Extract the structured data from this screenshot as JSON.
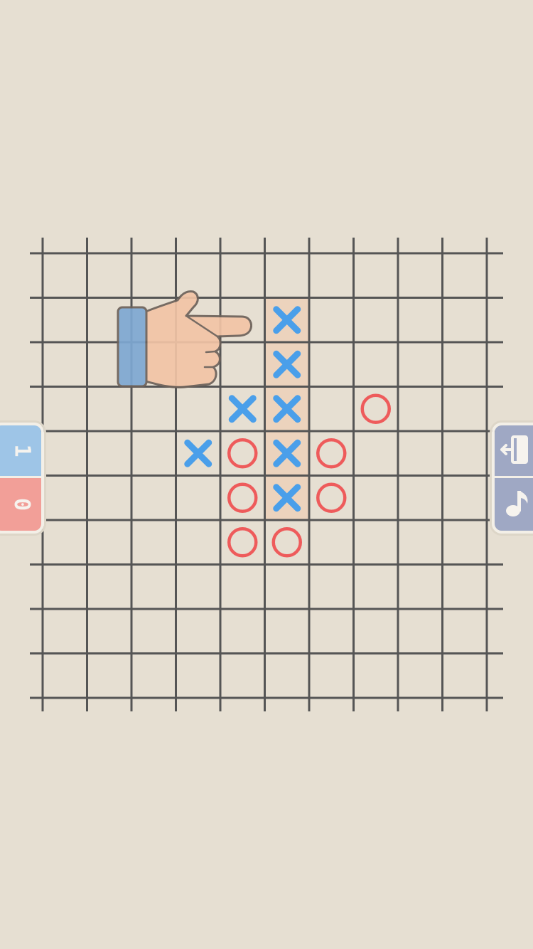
{
  "board": {
    "rows": 10,
    "cols": 10,
    "line_color": "#555555",
    "highlight_color": "#ecd3bd",
    "x_color": "#4a9fea",
    "o_color": "#ee5b5b",
    "winning_line": [
      [
        1,
        5
      ],
      [
        2,
        5
      ],
      [
        3,
        5
      ],
      [
        4,
        5
      ],
      [
        5,
        5
      ]
    ],
    "pieces": [
      {
        "r": 1,
        "c": 5,
        "type": "X"
      },
      {
        "r": 2,
        "c": 5,
        "type": "X"
      },
      {
        "r": 3,
        "c": 4,
        "type": "X"
      },
      {
        "r": 3,
        "c": 5,
        "type": "X"
      },
      {
        "r": 3,
        "c": 7,
        "type": "O"
      },
      {
        "r": 4,
        "c": 3,
        "type": "X"
      },
      {
        "r": 4,
        "c": 4,
        "type": "O"
      },
      {
        "r": 4,
        "c": 5,
        "type": "X"
      },
      {
        "r": 4,
        "c": 6,
        "type": "O"
      },
      {
        "r": 5,
        "c": 4,
        "type": "O"
      },
      {
        "r": 5,
        "c": 5,
        "type": "X"
      },
      {
        "r": 5,
        "c": 6,
        "type": "O"
      },
      {
        "r": 6,
        "c": 4,
        "type": "O"
      },
      {
        "r": 6,
        "c": 5,
        "type": "O"
      }
    ]
  },
  "scores": {
    "blue": "1",
    "red": "0",
    "blue_color": "#9ec5e7",
    "red_color": "#f29f98"
  },
  "menu": {
    "exit_icon": "exit-door-icon",
    "music_icon": "music-note-icon",
    "button_color": "#9fa8c4"
  },
  "hint": {
    "icon": "pointing-hand-icon"
  }
}
